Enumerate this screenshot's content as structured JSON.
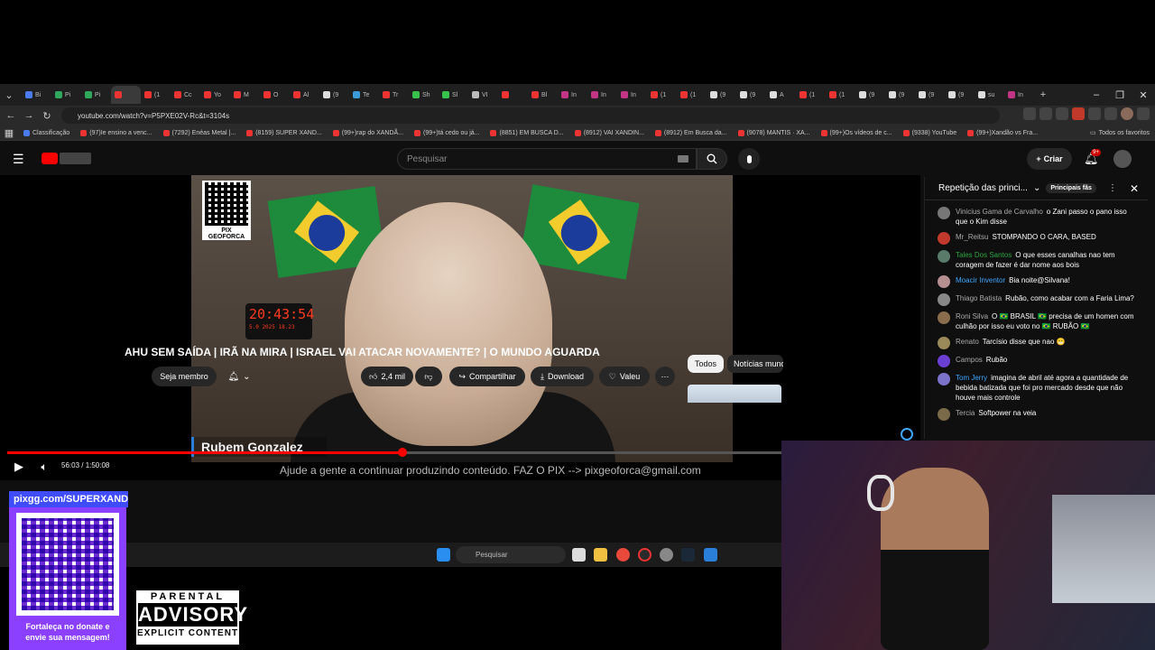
{
  "browser": {
    "tabs": [
      "Bi",
      "Pi",
      "Pi",
      "",
      "(1",
      "Cc",
      "Yo",
      "M",
      "O",
      "Al",
      "(9",
      "Te",
      "Tr",
      "Sh",
      "Sl",
      "VI",
      "",
      "Bl",
      "In",
      "In",
      "In",
      "(1",
      "(1",
      "(9",
      "(9",
      "A",
      "(1",
      "(1",
      "(9",
      "(9",
      "(9",
      "(9",
      "su",
      "In"
    ],
    "tab_colors": [
      "#4a7cf0",
      "#2fa85b",
      "#2fa85b",
      "#e33",
      "#e33",
      "#e33",
      "#e33",
      "#e33",
      "#e33",
      "#e33",
      "#ddd",
      "#3a9bd8",
      "#e33",
      "#37c24d",
      "#37c24d",
      "#bbb",
      "#e33",
      "#e33",
      "#c13584",
      "#c13584",
      "#c13584",
      "#e33",
      "#e33",
      "#ddd",
      "#ddd",
      "#ddd",
      "#e33",
      "#e33",
      "#ddd",
      "#ddd",
      "#ddd",
      "#ddd",
      "#ddd",
      "#c13584"
    ],
    "active_tab_index": 3,
    "url": "youtube.com/watch?v=P5PXE02V-Rc&t=3104s",
    "bookmarks": [
      "Classificação",
      "(97)Ie ensino a venc...",
      "(7292) Enéas Metal |...",
      "(8159) SUPER XAND...",
      "(99+)rap do XANDÃ...",
      "(99+)tá cedo ou já...",
      "(8851) EM BUSCA D...",
      "(8912) VAI XANDIN...",
      "(8912) Em Busca da...",
      "(9078) MANTIS · XA...",
      "(99+)Os vídeos de c...",
      "(9338) YouTube",
      "(99+)Xandão vs Fra..."
    ],
    "all_bookmarks": "Todos os favoritos"
  },
  "youtube": {
    "search_placeholder": "Pesquisar",
    "create_label": "Criar",
    "notifications_badge": "9+"
  },
  "player": {
    "qr_label": "PIX GEOFORCA",
    "clock_time": "20:43:54",
    "clock_date": "5.0 2025    18.23",
    "name_tag": "Rubem Gonzalez",
    "ticker": "Ajude a gente a continuar produzindo conteúdo. FAZ O PIX --> pixgeoforca@gmail.com",
    "time": "56:03 / 1:50:08",
    "progress": 0.509
  },
  "video": {
    "title": "AHU SEM SAÍDA | IRÃ NA MIRA | ISRAEL VAI ATACAR NOVAMENTE? | O MUNDO AGUARDA",
    "member_label": "Seja membro",
    "likes": "2,4 mil",
    "share_label": "Compartilhar",
    "download_label": "Download",
    "thanks_label": "Valeu"
  },
  "chips": [
    "Todos",
    "Notícias mundiais"
  ],
  "chat": {
    "header": "Repetição das princi...",
    "fans_label": "Principais fãs",
    "messages": [
      {
        "author": "Vinicius Gama de Carvalho",
        "text": "o Zani passo o pano isso que o Kim disse",
        "style": "",
        "color": "#777"
      },
      {
        "author": "Mr_Reitsu",
        "text": "STOMPANDO O CARA, BASED",
        "style": "",
        "color": "#c0392b"
      },
      {
        "author": "Tales Dos Santos",
        "text": "O que esses canalhas nao tem coragem de fazer é dar nome aos bois",
        "style": "green",
        "color": "#5a7a6a"
      },
      {
        "author": "Moacir Inventor",
        "text": "Bia noite@Silvana!",
        "style": "blue",
        "color": "#b58f8f"
      },
      {
        "author": "Thiago Batista",
        "text": "Rubão, como acabar com a Faria Lima?",
        "style": "",
        "color": "#888"
      },
      {
        "author": "Roni Silva",
        "text": "O 🇧🇷 BRASIL 🇧🇷 precisa de um homen com culhão por isso eu voto no 🇧🇷 RUBÃO 🇧🇷",
        "style": "",
        "color": "#8a6d4b"
      },
      {
        "author": "Renato",
        "text": "Tarcísio disse que nao 😬",
        "style": "",
        "color": "#9a8a5a"
      },
      {
        "author": "Campos",
        "text": "Rubão",
        "style": "",
        "color": "#6b3fd4"
      },
      {
        "author": "Tom Jerry",
        "text": "imagina de abril até agora a quantidade de bebida batizada que foi pro mercado desde que não houve mais controle",
        "style": "blue",
        "color": "#7b73c9"
      },
      {
        "author": "Tercia",
        "text": "Softpower na veia",
        "style": "",
        "color": "#7a6a4a"
      }
    ]
  },
  "taskbar": {
    "search_placeholder": "Pesquisar"
  },
  "overlay": {
    "pix_url": "pixgg.com/SUPERXANDÃO",
    "pix_cta_line1": "Fortaleça no donate e",
    "pix_cta_line2": "envie sua mensagem!",
    "advisory_top": "PARENTAL",
    "advisory_mid": "ADVISORY",
    "advisory_bot": "EXPLICIT CONTENT"
  }
}
